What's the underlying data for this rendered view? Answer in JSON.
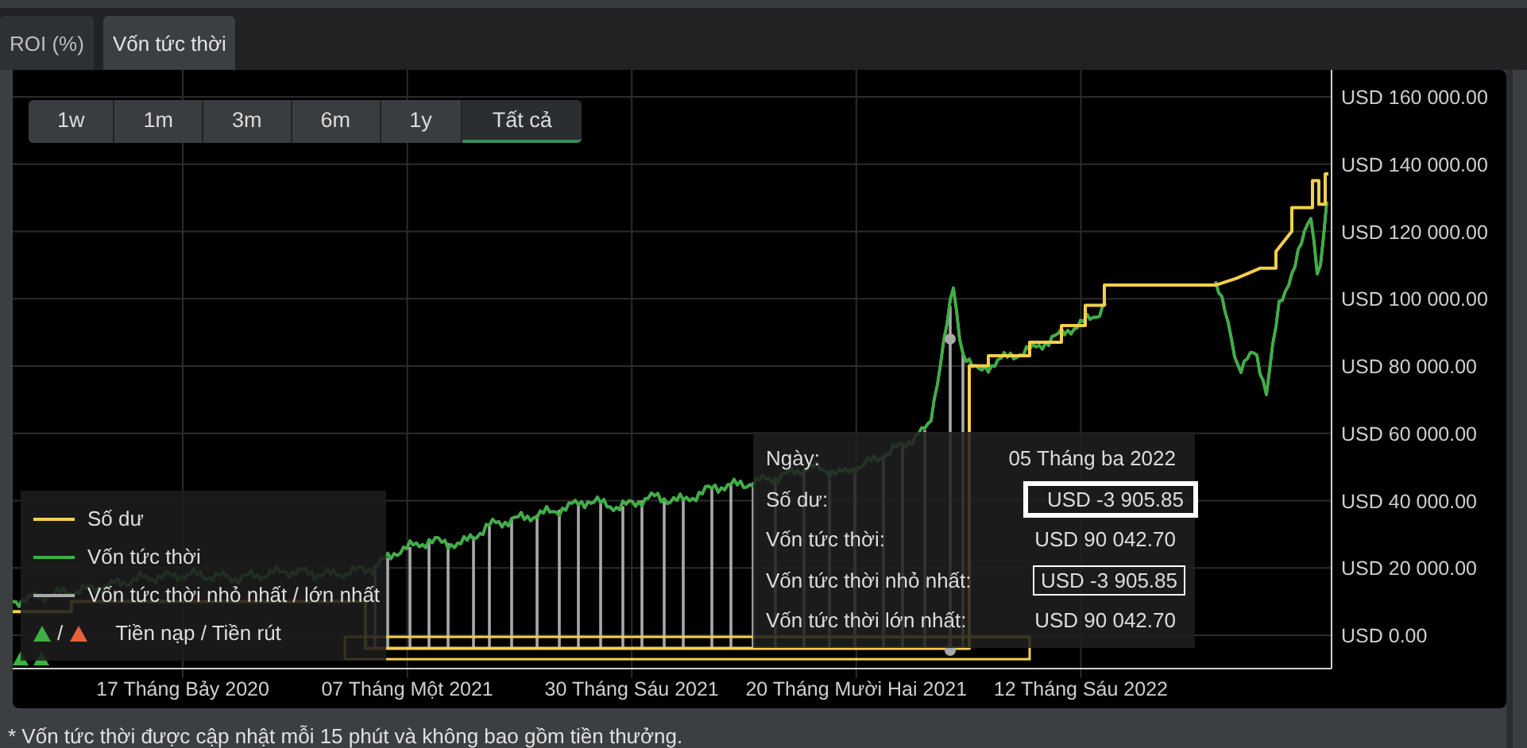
{
  "tabs": [
    {
      "label": "ROI (%)",
      "selected": false
    },
    {
      "label": "Vốn tức thời",
      "selected": true
    }
  ],
  "range_buttons": [
    {
      "label": "1w",
      "selected": false
    },
    {
      "label": "1m",
      "selected": false
    },
    {
      "label": "3m",
      "selected": false
    },
    {
      "label": "6m",
      "selected": false
    },
    {
      "label": "1y",
      "selected": false
    },
    {
      "label": "Tất cả",
      "selected": true
    }
  ],
  "chart": {
    "y_axis_labels": [
      "USD 160 000.00",
      "USD 140 000.00",
      "USD 120 000.00",
      "USD 100 000.00",
      "USD 80 000.00",
      "USD 60 000.00",
      "USD 40 000.00",
      "USD 20 000.00",
      "USD 0.00"
    ],
    "x_axis_labels": [
      "17 Tháng Bảy 2020",
      "07 Tháng Một 2021",
      "30 Tháng Sáu 2021",
      "20 Tháng Mười Hai 2021",
      "12 Tháng Sáu 2022"
    ],
    "legend": [
      {
        "kind": "line",
        "label": "Số dư",
        "color": "#f2d04a"
      },
      {
        "kind": "line",
        "label": "Vốn tức thời",
        "color": "#3cb043"
      },
      {
        "kind": "line",
        "label": "Vốn tức thời nhỏ nhất / lớn nhất",
        "color": "#a9a9a9"
      },
      {
        "kind": "markers",
        "label": "Tiền nạp / Tiền rút",
        "separator": "/",
        "markers": [
          {
            "color": "#3cb043"
          },
          {
            "color": "#e8603c"
          }
        ]
      }
    ],
    "tooltip": [
      {
        "label": "Ngày:",
        "value": "05 Tháng ba 2022",
        "framed": false
      },
      {
        "label": "Số dư:",
        "value": "USD -3 905.85",
        "framed": true,
        "bold_frame": true
      },
      {
        "label": "Vốn tức thời:",
        "value": "USD 90 042.70",
        "framed": false
      },
      {
        "label": "Vốn tức thời nhỏ nhất:",
        "value": "USD -3 905.85",
        "framed": true,
        "bold_frame": false
      },
      {
        "label": "Vốn tức thời lớn nhất:",
        "value": "USD 90 042.70",
        "framed": false
      }
    ]
  },
  "footnote": "* Vốn tức thời được cập nhật mỗi 15 phút và không bao gồm tiền thưởng."
}
